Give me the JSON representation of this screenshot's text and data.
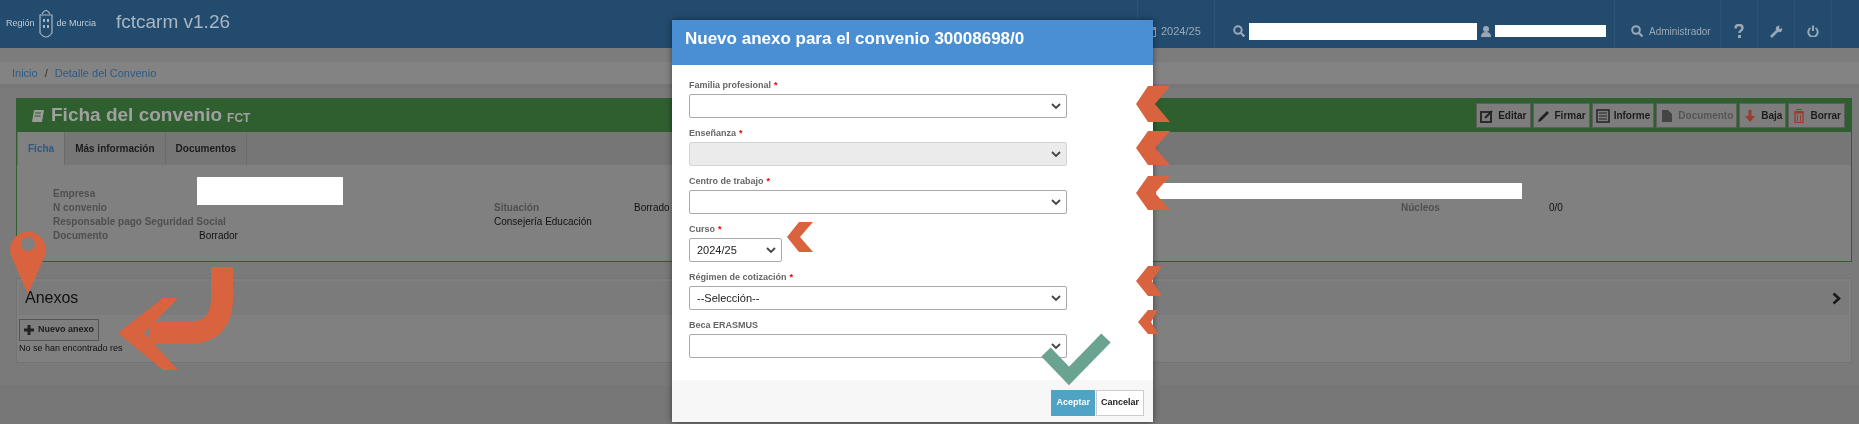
{
  "header": {
    "logo_left": "Región",
    "logo_right": "de Murcia",
    "app_title": "fctcarm v1.26",
    "items": [
      {
        "kind": "course",
        "text": "2024/25"
      },
      {
        "kind": "search",
        "redacted": true
      },
      {
        "kind": "user",
        "redacted": true
      },
      {
        "kind": "role",
        "text": "Administrador"
      },
      {
        "kind": "help"
      },
      {
        "kind": "settings"
      },
      {
        "kind": "power"
      }
    ]
  },
  "breadcrumb": [
    "Inicio",
    "Detalle del Convenio"
  ],
  "breadcrumb_separator": "/",
  "card": {
    "title": "Ficha del convenio",
    "subtitle": "FCT",
    "actions": [
      {
        "kind": "edit",
        "label": "Editar",
        "disabled": false
      },
      {
        "kind": "sign",
        "label": "Firmar",
        "disabled": false
      },
      {
        "kind": "report",
        "label": "Informe",
        "disabled": false
      },
      {
        "kind": "document",
        "label": "Documento",
        "disabled": true
      },
      {
        "kind": "drop",
        "label": "Baja",
        "disabled": false
      },
      {
        "kind": "delete",
        "label": "Borrar",
        "disabled": false
      }
    ],
    "tabs": [
      {
        "label": "Ficha",
        "selected": true
      },
      {
        "label": "Más información",
        "selected": false
      },
      {
        "label": "Documentos",
        "selected": false
      }
    ],
    "rows": [
      {
        "column_1": {
          "kind": "label",
          "text": "Empresa"
        },
        "column_2": {
          "kind": "redacted"
        },
        "column_4": {
          "kind": "redacted"
        }
      },
      {
        "column_1": {
          "kind": "label",
          "text": "N convenio"
        },
        "column_3": {
          "kind": "label",
          "text": "Situación"
        },
        "column_4": {
          "kind": "value",
          "text": "Borrado"
        },
        "column_5": {
          "kind": "label",
          "text": "Núcleos"
        },
        "column_6": {
          "kind": "value",
          "text": "0/0"
        }
      },
      {
        "column_1": {
          "kind": "label",
          "text": "Responsable pago Seguridad Social"
        },
        "column_3": {
          "kind": "value",
          "text": "Consejería Educación"
        }
      },
      {
        "column_1": {
          "kind": "label",
          "text": "Documento"
        },
        "column_2": {
          "kind": "value",
          "text": "Borrador"
        }
      }
    ]
  },
  "anexos": {
    "title": "Anexos",
    "button": "Nuevo anexo",
    "empty_text": "No se han encontrado res"
  },
  "modal": {
    "title": "Nuevo anexo para el convenio 30008698/0",
    "fields": [
      {
        "kind": "select",
        "label": "Familia profesional",
        "required_mark": "*",
        "disabled": false
      },
      {
        "kind": "select",
        "label": "Enseñanza",
        "required_mark": "*",
        "disabled": true
      },
      {
        "kind": "select",
        "label": "Centro de trabajo",
        "required_mark": "*",
        "disabled": false
      },
      {
        "kind": "short_select",
        "label": "Curso",
        "required_mark": "*",
        "value": "2024/25",
        "disabled": false
      },
      {
        "kind": "select",
        "label": "Régimen de cotización",
        "required_mark": "*",
        "value": "--Selección--",
        "disabled": false
      },
      {
        "kind": "select",
        "label": "Beca ERASMUS",
        "disabled": false
      }
    ],
    "buttons": [
      {
        "label": "Aceptar",
        "primary": true
      },
      {
        "label": "Cancelar",
        "primary": false
      }
    ]
  }
}
